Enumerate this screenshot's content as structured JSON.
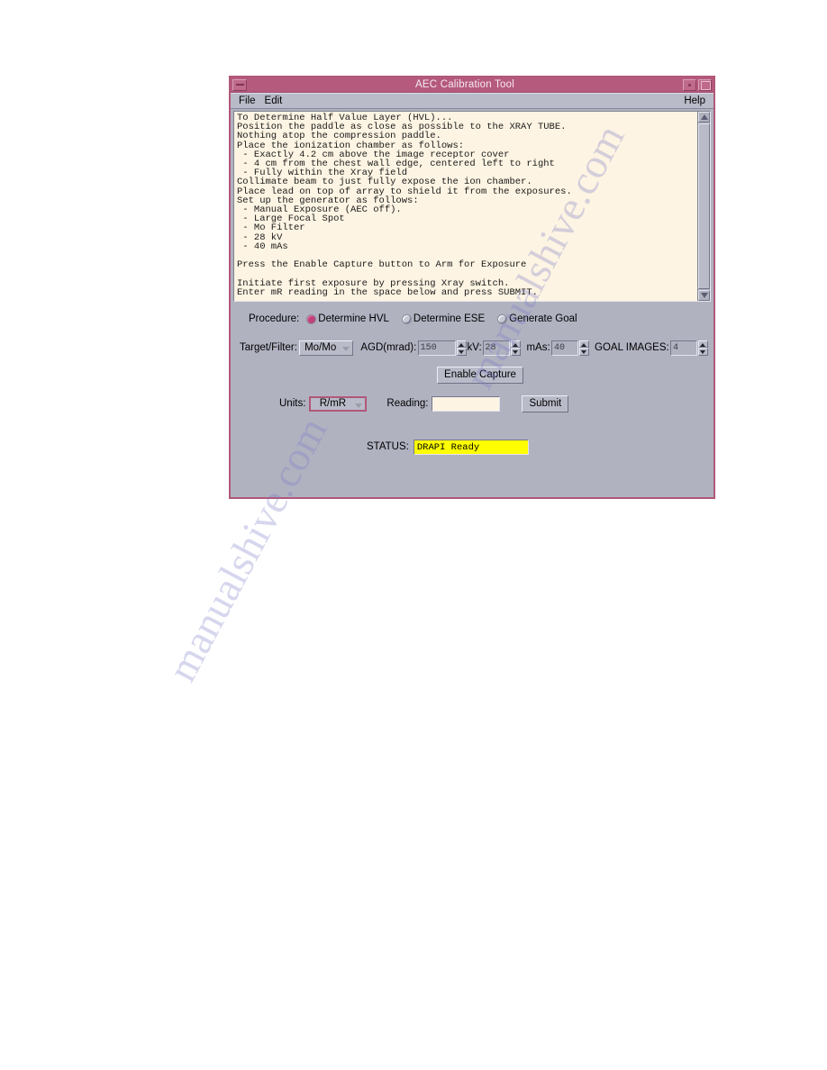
{
  "window": {
    "title": "AEC Calibration Tool",
    "minimize_icon": "window-minimize-icon",
    "restore_icon": "window-restore-icon",
    "maximize_icon": "window-maximize-icon"
  },
  "menu": {
    "items": [
      "File",
      "Edit"
    ],
    "help": "Help"
  },
  "instructions": {
    "text": "To Determine Half Value Layer (HVL)...\nPosition the paddle as close as possible to the XRAY TUBE.\nNothing atop the compression paddle.\nPlace the ionization chamber as follows:\n - Exactly 4.2 cm above the image receptor cover\n - 4 cm from the chest wall edge, centered left to right\n - Fully within the Xray field\nCollimate beam to just fully expose the ion chamber.\nPlace lead on top of array to shield it from the exposures.\nSet up the generator as follows:\n - Manual Exposure (AEC off).\n - Large Focal Spot\n - Mo Filter\n - 28 kV\n - 40 mAs\n\nPress the Enable Capture button to Arm for Exposure\n\nInitiate first exposure by pressing Xray switch.\nEnter mR reading in the space below and press SUBMIT."
  },
  "procedure": {
    "label": "Procedure:",
    "options": [
      {
        "label": "Determine HVL",
        "selected": true
      },
      {
        "label": "Determine ESE",
        "selected": false
      },
      {
        "label": "Generate Goal",
        "selected": false
      }
    ]
  },
  "params": {
    "target_filter_label": "Target/Filter:",
    "target_filter_value": "Mo/Mo",
    "agd_label": "AGD(mrad):",
    "agd_value": "150",
    "kv_label": "kV:",
    "kv_value": "28",
    "mas_label": "mAs:",
    "mas_value": "40",
    "goal_images_label": "GOAL IMAGES:",
    "goal_images_value": "4"
  },
  "actions": {
    "enable_capture": "Enable Capture",
    "units_label": "Units:",
    "units_value": "R/mR",
    "reading_label": "Reading:",
    "reading_value": "",
    "reading_placeholder": "",
    "submit": "Submit"
  },
  "status": {
    "label": "STATUS:",
    "value": "DRAPI Ready"
  },
  "colors": {
    "titlebar": "#b55a7d",
    "frame_border": "#b05878",
    "window_bg": "#b0b2c0",
    "text_area_bg": "#fdf4e3",
    "status_bg": "#ffff00",
    "radio_selected": "#c2417a"
  },
  "watermark": {
    "lines": [
      "manualshive.com",
      "manualshive.com",
      "manualshive.com"
    ]
  }
}
